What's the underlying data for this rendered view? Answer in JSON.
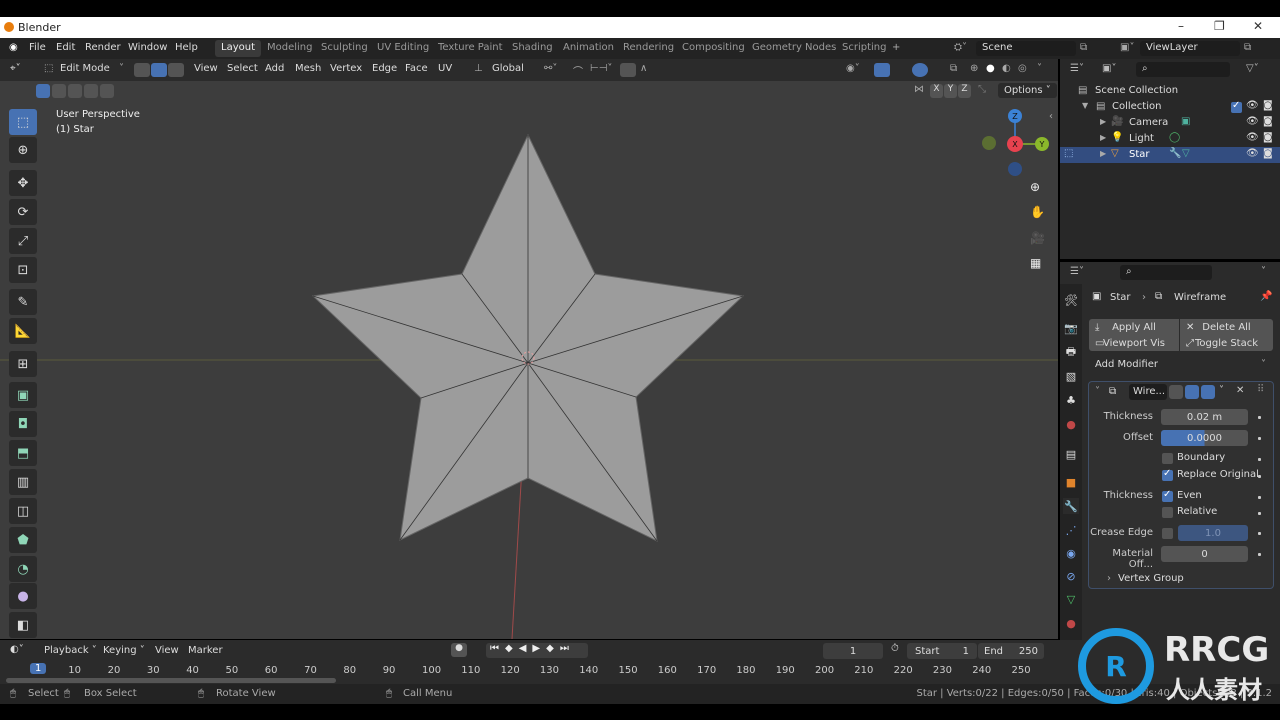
{
  "window": {
    "title": "Blender",
    "controls": [
      "minimize",
      "maximize",
      "close"
    ]
  },
  "menu": [
    "File",
    "Edit",
    "Render",
    "Window",
    "Help"
  ],
  "workspaces": [
    {
      "label": "Layout",
      "active": true
    },
    {
      "label": "Modeling"
    },
    {
      "label": "Sculpting"
    },
    {
      "label": "UV Editing"
    },
    {
      "label": "Texture Paint"
    },
    {
      "label": "Shading"
    },
    {
      "label": "Animation"
    },
    {
      "label": "Rendering"
    },
    {
      "label": "Compositing"
    },
    {
      "label": "Geometry Nodes"
    },
    {
      "label": "Scripting"
    }
  ],
  "scene": {
    "name": "Scene",
    "view_layer": "ViewLayer"
  },
  "viewport_header": {
    "mode": "Edit Mode",
    "menus": [
      "View",
      "Select",
      "Add",
      "Mesh",
      "Vertex",
      "Edge",
      "Face",
      "UV"
    ],
    "orientation": "Global",
    "axes": [
      "X",
      "Y",
      "Z"
    ],
    "options": "Options"
  },
  "viewport": {
    "perspective": "User Perspective",
    "object": "(1) Star",
    "gizmo": {
      "x": "X",
      "y": "Y",
      "z": "Z"
    },
    "colors": {
      "x": "#e8424f",
      "y": "#8bb82b",
      "z": "#3b82d6"
    }
  },
  "outliner": {
    "items": [
      {
        "label": "Scene Collection",
        "level": 0
      },
      {
        "label": "Collection",
        "level": 1
      },
      {
        "label": "Camera",
        "level": 2
      },
      {
        "label": "Light",
        "level": 2
      },
      {
        "label": "Star",
        "level": 2,
        "selected": true
      }
    ]
  },
  "properties": {
    "breadcrumb": [
      "Star",
      "Wireframe"
    ],
    "buttons": {
      "apply_all": "Apply All",
      "delete_all": "Delete All",
      "viewport_vis": "Viewport Vis",
      "toggle_stack": "Toggle Stack"
    },
    "add_modifier": "Add Modifier",
    "modifier": {
      "name": "Wire...",
      "thickness_label": "Thickness",
      "thickness": "0.02 m",
      "offset_label": "Offset",
      "offset": "0.0000",
      "boundary": {
        "label": "Boundary",
        "checked": false
      },
      "replace_original": {
        "label": "Replace Original",
        "checked": true
      },
      "thickness2_label": "Thickness",
      "even": {
        "label": "Even",
        "checked": true
      },
      "relative": {
        "label": "Relative",
        "checked": false
      },
      "crease_label": "Crease Edge",
      "crease": "1.0",
      "material_label": "Material Off...",
      "material": "0",
      "vertex_group": "Vertex Group"
    }
  },
  "timeline": {
    "menus": [
      "Playback",
      "Keying",
      "View",
      "Marker"
    ],
    "current_frame": "1",
    "start_label": "Start",
    "start": "1",
    "end_label": "End",
    "end": "250",
    "ticks": [
      "1",
      "10",
      "20",
      "30",
      "40",
      "50",
      "60",
      "70",
      "80",
      "90",
      "100",
      "110",
      "120",
      "130",
      "140",
      "150",
      "160",
      "170",
      "180",
      "190",
      "200",
      "210",
      "220",
      "230",
      "240",
      "250"
    ]
  },
  "statusbar": {
    "select": "Select",
    "box_select": "Box Select",
    "rotate_view": "Rotate View",
    "call_menu": "Call Menu",
    "stats": "Star | Verts:0/22 | Edges:0/50 | Faces:0/30 | Tris:40 | Objects:1/3 | 3.1.2"
  },
  "watermark": {
    "brand": "RRCG",
    "sub": "人人素材"
  }
}
